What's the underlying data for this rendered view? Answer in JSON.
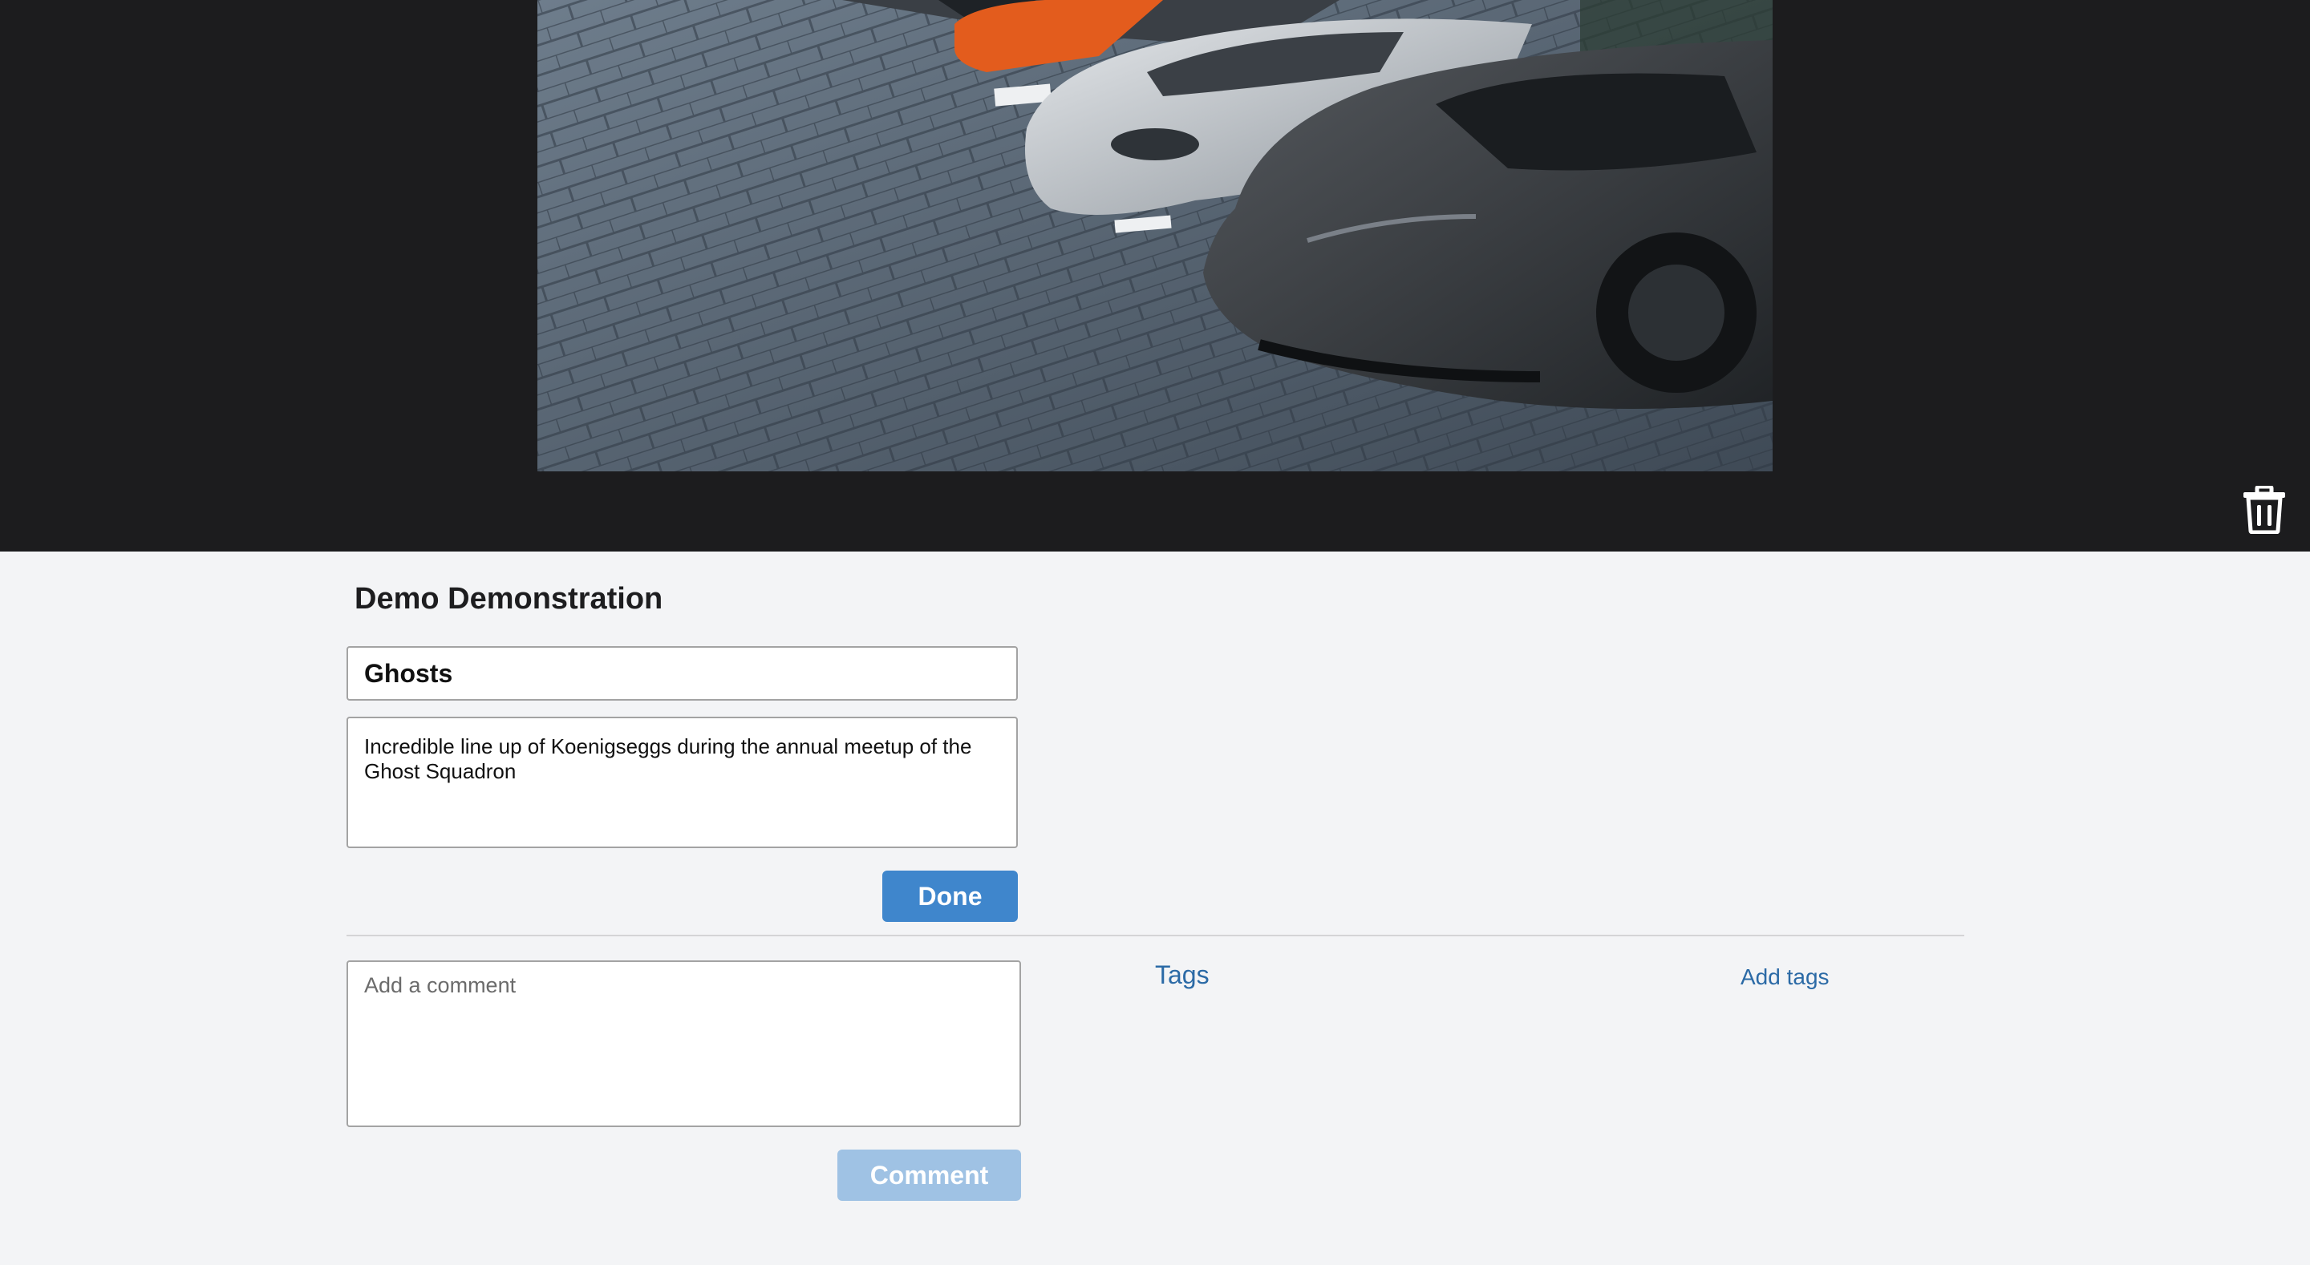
{
  "viewer": {
    "photo_icon": "photo-image",
    "delete_icon": "trash-icon"
  },
  "album": {
    "title": "Demo Demonstration"
  },
  "photo_details": {
    "name_value": "Ghosts",
    "description_value": "Incredible line up of Koenigseggs during the annual meetup of the Ghost Squadron",
    "done_label": "Done"
  },
  "comments": {
    "placeholder": "Add a comment",
    "submit_label": "Comment"
  },
  "tags": {
    "label": "Tags",
    "add_label": "Add tags"
  },
  "colors": {
    "accent": "#3f86cc",
    "accent_disabled": "#9fc2e4",
    "link": "#2b6aa6",
    "viewer_bg": "#1c1c1e",
    "page_bg": "#f3f4f6"
  }
}
